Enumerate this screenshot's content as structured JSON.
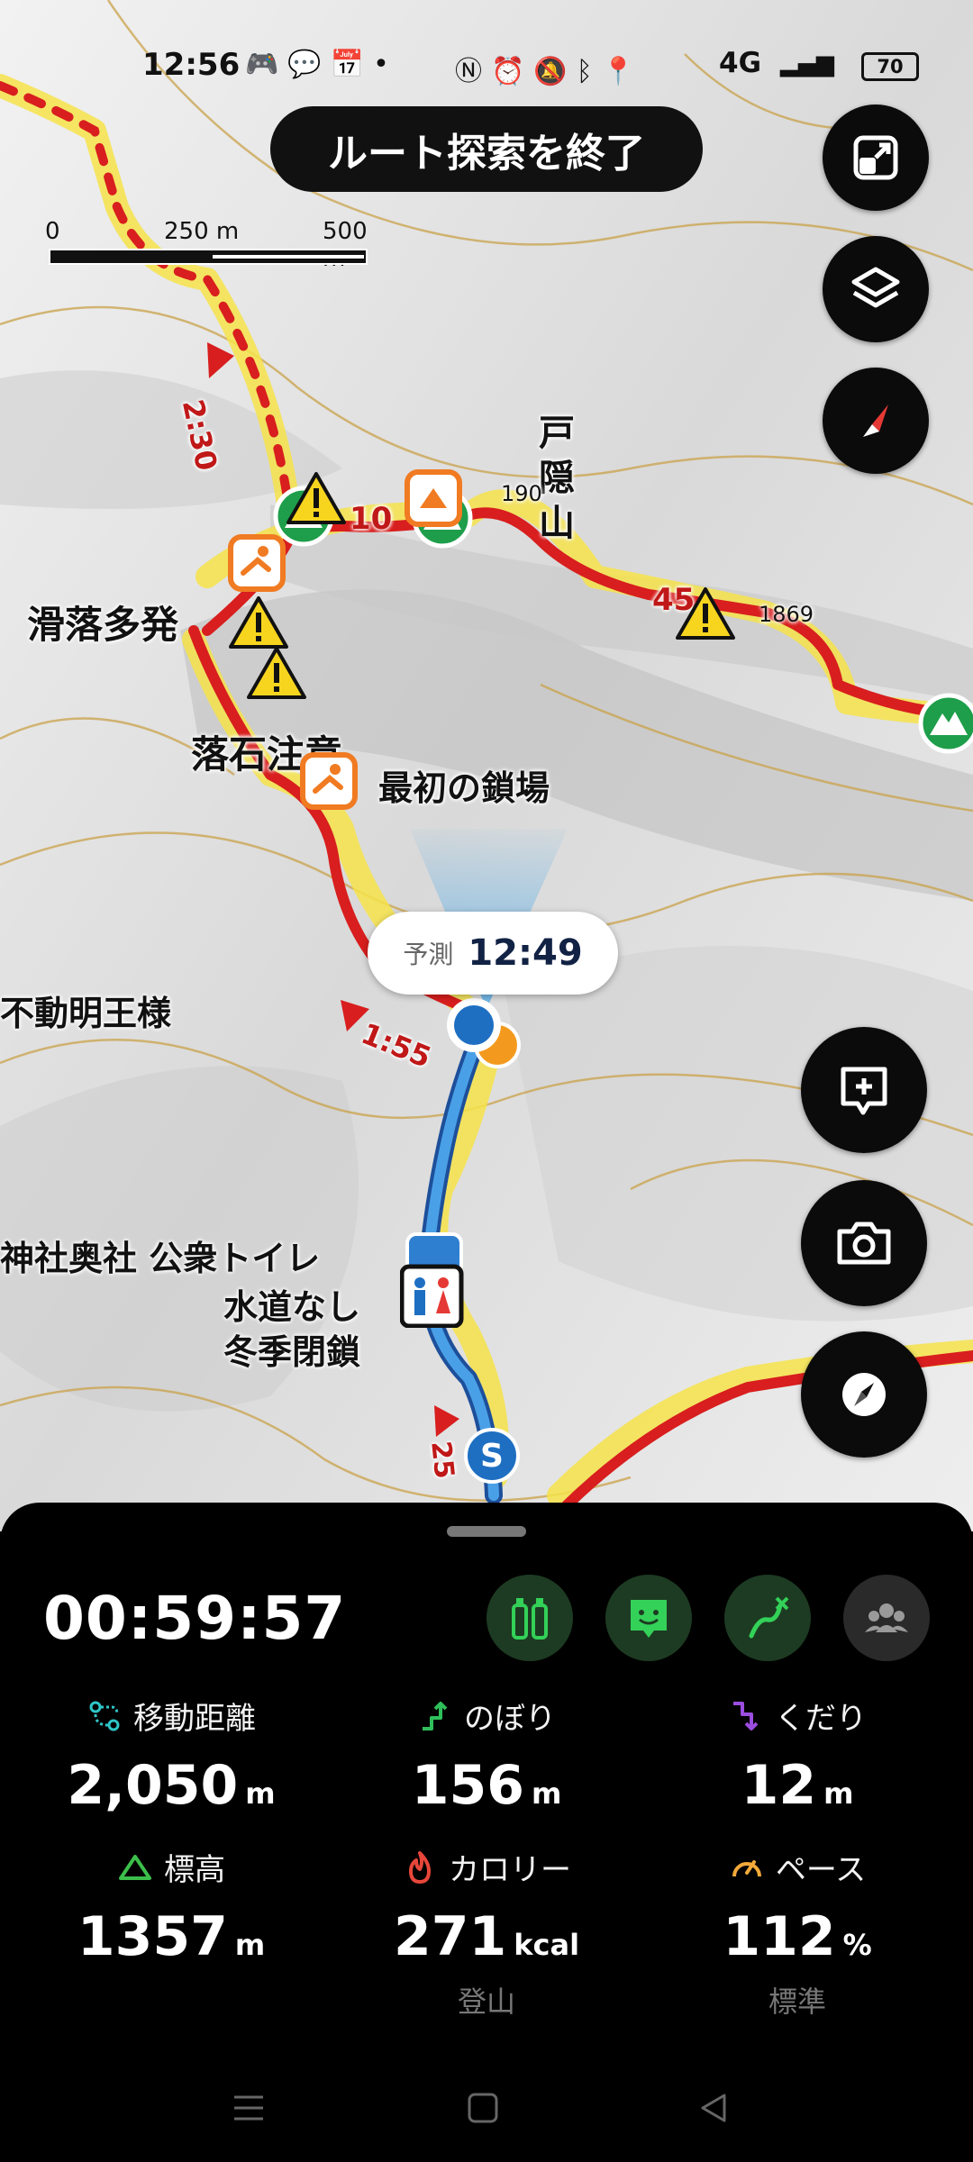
{
  "status_bar": {
    "time": "12:56",
    "network": "4G",
    "battery": "70"
  },
  "map": {
    "end_route_button": "ルート探索を終了",
    "scale": {
      "zero": "0",
      "mid": "250 m",
      "max": "500 m"
    },
    "labels": {
      "togakushi_line1": "戸",
      "togakushi_line2": "隠",
      "togakushi_line3": "山",
      "kassharaku": "滑落多発",
      "rakuseki": "落石注意",
      "first_chain": "最初の鎖場",
      "fudo": "不動明王様",
      "shrine_toilet": "神社奥社 公衆トイレ",
      "no_water": "水道なし",
      "winter_closed": "冬季閉鎖",
      "elev_1904": "190",
      "elev_1869": "1869",
      "time_230": "2:30",
      "time_10": "10",
      "time_45": "45",
      "time_155": "1:55",
      "time_25": "25",
      "start_marker": "S"
    },
    "prediction": {
      "label": "予測",
      "time": "12:49"
    },
    "colors": {
      "route_red": "#d81e1e",
      "route_blue": "#2f7fd1",
      "halo_yellow": "#f6e34a",
      "summit_green": "#1e9e4a"
    }
  },
  "panel": {
    "elapsed_time": "00:59:57",
    "stats": [
      {
        "label": "移動距離",
        "value": "2,050",
        "unit": "m",
        "sub": "",
        "icon": "distance-icon",
        "color": "#2fc6c8"
      },
      {
        "label": "のぼり",
        "value": "156",
        "unit": "m",
        "sub": "",
        "icon": "ascent-icon",
        "color": "#2fbf5a"
      },
      {
        "label": "くだり",
        "value": "12",
        "unit": "m",
        "sub": "",
        "icon": "descent-icon",
        "color": "#9b4de0"
      },
      {
        "label": "標高",
        "value": "1357",
        "unit": "m",
        "sub": "",
        "icon": "mountain-icon",
        "color": "#3cbf4a"
      },
      {
        "label": "カロリー",
        "value": "271",
        "unit": "kcal",
        "sub": "登山",
        "icon": "flame-icon",
        "color": "#e8463a"
      },
      {
        "label": "ペース",
        "value": "112",
        "unit": "%",
        "sub": "標準",
        "icon": "speedometer-icon",
        "color": "#f2a93a"
      }
    ]
  }
}
